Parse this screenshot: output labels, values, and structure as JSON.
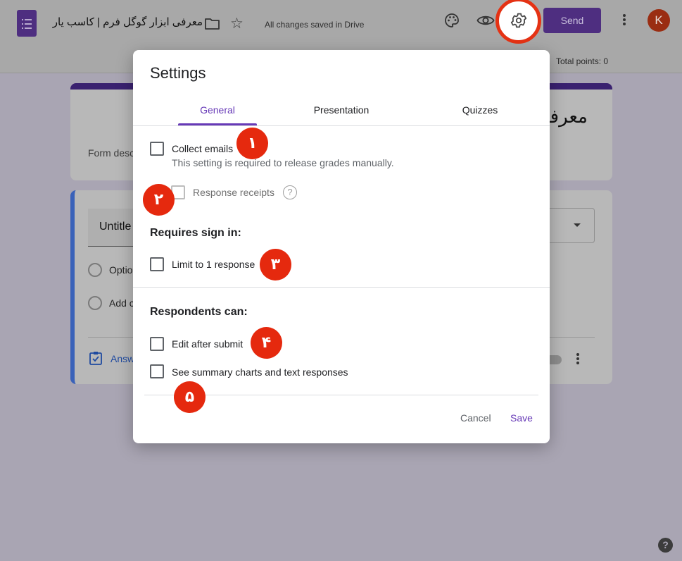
{
  "header": {
    "doc_title": "معرفی ابزار گوگل فرم | کاسب یار",
    "save_status": "All changes saved in Drive",
    "send_label": "Send",
    "avatar_letter": "K",
    "total_points": "Total points: 0",
    "icons": [
      "forms-logo-icon",
      "folder-icon",
      "star-icon",
      "palette-icon",
      "eye-icon",
      "gear-icon",
      "more-vert-icon"
    ]
  },
  "form": {
    "title": "معرفی",
    "description": "Form desc",
    "question_title": "Untitle",
    "option_1": "Optio",
    "add_option": "Add c",
    "answer_key": "Answ"
  },
  "dialog": {
    "title": "Settings",
    "tabs": [
      {
        "label": "General",
        "active": true
      },
      {
        "label": "Presentation",
        "active": false
      },
      {
        "label": "Quizzes",
        "active": false
      }
    ],
    "collect_emails": {
      "label": "Collect emails",
      "checked": false,
      "helper": "This setting is required to release grades manually."
    },
    "response_receipts": {
      "label": "Response receipts",
      "checked": false,
      "disabled": true
    },
    "requires_sign_in": {
      "heading": "Requires sign in:",
      "limit_label": "Limit to 1 response",
      "checked": false
    },
    "respondents_can": {
      "heading": "Respondents can:",
      "edit_label": "Edit after submit",
      "summary_label": "See summary charts and text responses"
    },
    "cancel_label": "Cancel",
    "save_label": "Save"
  },
  "markers": [
    "۱",
    "۲",
    "۳",
    "۴",
    "۵"
  ],
  "colors": {
    "accent": "#673ab7",
    "marker": "#e5290e",
    "header_purple": "#4e2e80"
  }
}
